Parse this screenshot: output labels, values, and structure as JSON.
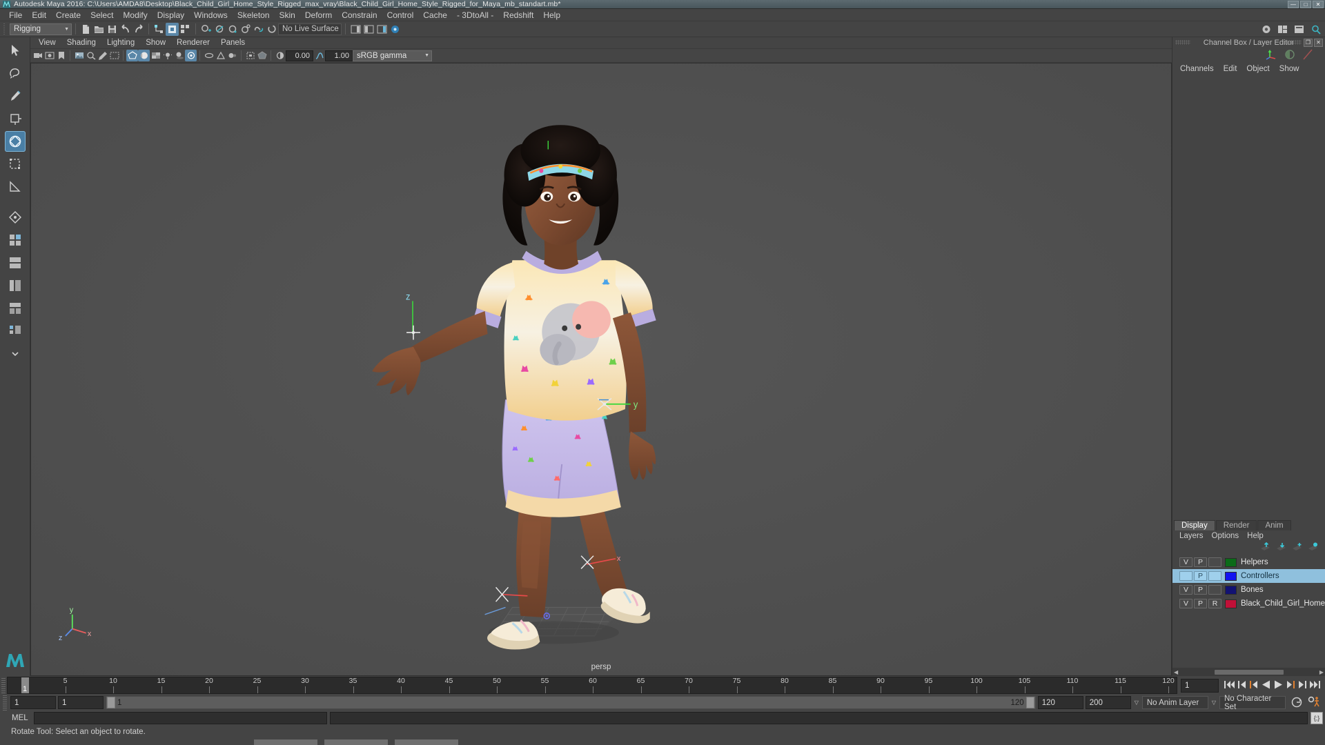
{
  "window": {
    "title": "Autodesk Maya 2016: C:\\Users\\AMDA8\\Desktop\\Black_Child_Girl_Home_Style_Rigged_max_vray\\Black_Child_Girl_Home_Style_Rigged_for_Maya_mb_standart.mb*",
    "minimize": "—",
    "maximize": "□",
    "close": "✕"
  },
  "menubar": {
    "items": [
      "File",
      "Edit",
      "Create",
      "Select",
      "Modify",
      "Display",
      "Windows",
      "Skeleton",
      "Skin",
      "Deform",
      "Constrain",
      "Control",
      "Cache",
      "- 3DtoAll -",
      "Redshift",
      "Help"
    ]
  },
  "toolbar": {
    "menuset": "Rigging",
    "live_surface": "No Live Surface"
  },
  "viewport_panel": {
    "menus": [
      "View",
      "Shading",
      "Lighting",
      "Show",
      "Renderer",
      "Panels"
    ],
    "exposure": "0.00",
    "gamma": "1.00",
    "color_profile": "sRGB gamma",
    "camera_label": "persp",
    "axis_x": "x",
    "axis_y": "y",
    "axis_z": "z"
  },
  "channel_box": {
    "title": "Channel Box / Layer Editor",
    "menus": [
      "Channels",
      "Edit",
      "Object",
      "Show"
    ]
  },
  "layer_editor": {
    "tabs": [
      "Display",
      "Render",
      "Anim"
    ],
    "active_tab": "Display",
    "menus": [
      "Layers",
      "Options",
      "Help"
    ],
    "columns": [
      "V",
      "P",
      "R"
    ],
    "layers": [
      {
        "v": "V",
        "p": "P",
        "r": "",
        "color": "#0b6b18",
        "name": "Helpers",
        "selected": false
      },
      {
        "v": "",
        "p": "P",
        "r": "",
        "color": "#1212f0",
        "name": "Controllers",
        "selected": true
      },
      {
        "v": "V",
        "p": "P",
        "r": "",
        "color": "#121273",
        "name": "Bones",
        "selected": false
      },
      {
        "v": "V",
        "p": "P",
        "r": "R",
        "color": "#c01038",
        "name": "Black_Child_Girl_Home",
        "selected": false
      }
    ]
  },
  "timeline": {
    "ticks": [
      5,
      10,
      15,
      20,
      25,
      30,
      35,
      40,
      45,
      50,
      55,
      60,
      65,
      70,
      75,
      80,
      85,
      90,
      95,
      100,
      105,
      110,
      115,
      120
    ],
    "current_frame": "1",
    "current_frame_field": "1"
  },
  "range": {
    "start": "1",
    "anim_start": "1",
    "range_start_label": "1",
    "range_end_label": "120",
    "anim_end": "120",
    "playback_end": "200",
    "anim_layer": "No Anim Layer",
    "character_set": "No Character Set"
  },
  "command": {
    "label": "MEL",
    "input_value": "",
    "output_value": "",
    "script_editor_icon": "{;}"
  },
  "status": {
    "message": "Rotate Tool: Select an object to rotate."
  },
  "icons": {
    "maya_logo": "maya-logo-icon",
    "select_tool": "select-arrow-icon",
    "lasso_tool": "lasso-icon",
    "paint_select": "paint-brush-icon",
    "move_tool": "move-arrows-icon",
    "rotate_tool": "rotate-circle-icon",
    "scale_tool": "scale-box-icon",
    "last_tool": "last-tool-icon",
    "snap_grid": "snap-to-grid-icon",
    "snap_curve": "snap-to-curve-icon",
    "snap_point": "snap-to-point-icon",
    "new_scene": "new-scene-icon",
    "open_scene": "open-scene-icon",
    "save_scene": "save-scene-icon",
    "undo": "undo-arrow-icon",
    "redo": "redo-arrow-icon"
  }
}
